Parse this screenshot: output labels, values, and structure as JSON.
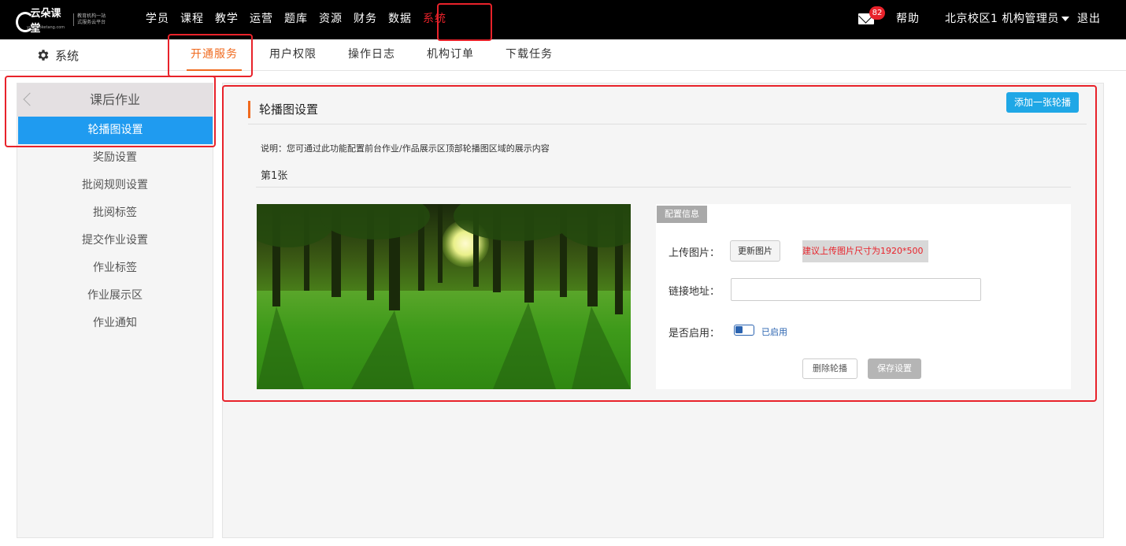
{
  "header": {
    "logo_text": "云朵课堂",
    "logo_tagline": "教育机构一站式服务云平台",
    "logo_url": "yunduoketang.com",
    "nav": [
      "学员",
      "课程",
      "教学",
      "运营",
      "题库",
      "资源",
      "财务",
      "数据",
      "系统"
    ],
    "active_nav": "系统",
    "mail_badge": "82",
    "help": "帮助",
    "user": "北京校区1 机构管理员",
    "logout": "退出"
  },
  "subnav": {
    "title": "系统",
    "tabs": [
      "开通服务",
      "用户权限",
      "操作日志",
      "机构订单",
      "下载任务"
    ],
    "active_tab": "开通服务"
  },
  "sidebar": {
    "title": "课后作业",
    "items": [
      "轮播图设置",
      "奖励设置",
      "批阅规则设置",
      "批阅标签",
      "提交作业设置",
      "作业标签",
      "作业展示区",
      "作业通知"
    ],
    "active_item": "轮播图设置"
  },
  "content": {
    "title": "轮播图设置",
    "add_button": "添加一张轮播",
    "description": "说明：您可通过此功能配置前台作业/作品展示区顶部轮播图区域的展示内容",
    "slide_label": "第1张",
    "config": {
      "tag": "配置信息",
      "upload_label": "上传图片：",
      "update_button": "更新图片",
      "upload_hint": "建议上传图片尺寸为1920*500",
      "link_label": "链接地址：",
      "link_value": "",
      "link_placeholder": "",
      "enable_label": "是否启用：",
      "enabled_text": "已启用",
      "delete_button": "删除轮播",
      "save_button": "保存设置"
    }
  },
  "colors": {
    "accent_orange": "#f06a1e",
    "active_blue": "#1f9bf0",
    "annotation_red": "#e8222a",
    "topbar": "#000000"
  }
}
